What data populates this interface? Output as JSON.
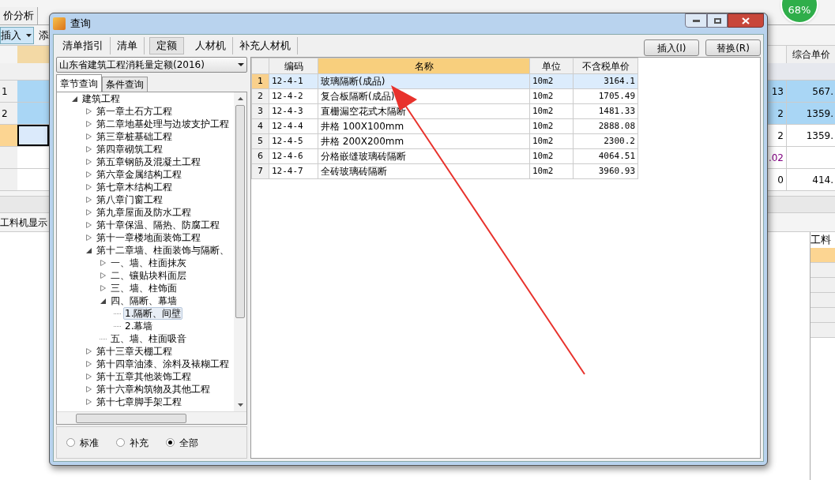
{
  "background": {
    "tab": "价分析",
    "insert_button": "插入",
    "add_button": "添",
    "progress": "68%",
    "price_header": "综合单价",
    "rows": [
      {
        "num": "1",
        "qty": "13",
        "price": "567.",
        "kind": "blue"
      },
      {
        "num": "2",
        "qty": "2",
        "price": "1359.",
        "kind": "blue"
      },
      {
        "num": "",
        "qty": "2",
        "price": "1359.",
        "kind": "current"
      },
      {
        "num": "",
        "qty": ".02",
        "price": "",
        "kind": "plain"
      },
      {
        "num": "",
        "qty": "0",
        "price": "414.",
        "kind": "plain"
      }
    ],
    "bottom_label": "工料机显示",
    "side_header": "工料"
  },
  "dialog": {
    "title": "查询",
    "tabs": [
      {
        "label": "清单指引",
        "selected": false
      },
      {
        "label": "清单",
        "selected": false
      },
      {
        "label": "定额",
        "selected": true
      },
      {
        "label": "人材机",
        "selected": false
      },
      {
        "label": "补充人材机",
        "selected": false
      }
    ],
    "buttons": [
      "插入(I)",
      "替换(R)"
    ],
    "library": "山东省建筑工程消耗量定额(2016)",
    "search_tabs": [
      {
        "label": "章节查询",
        "selected": true
      },
      {
        "label": "条件查询",
        "selected": false
      }
    ],
    "tree": [
      {
        "label": "建筑工程",
        "kind": "branch",
        "expanded": true,
        "selected": false,
        "children": [
          {
            "label": "第一章土石方工程",
            "kind": "branch",
            "expanded": false,
            "selected": false
          },
          {
            "label": "第二章地基处理与边坡支护工程",
            "kind": "branch",
            "expanded": false,
            "selected": false
          },
          {
            "label": "第三章桩基础工程",
            "kind": "branch",
            "expanded": false,
            "selected": false
          },
          {
            "label": "第四章砌筑工程",
            "kind": "branch",
            "expanded": false,
            "selected": false
          },
          {
            "label": "第五章钢筋及混凝土工程",
            "kind": "branch",
            "expanded": false,
            "selected": false
          },
          {
            "label": "第六章金属结构工程",
            "kind": "branch",
            "expanded": false,
            "selected": false
          },
          {
            "label": "第七章木结构工程",
            "kind": "branch",
            "expanded": false,
            "selected": false
          },
          {
            "label": "第八章门窗工程",
            "kind": "branch",
            "expanded": false,
            "selected": false
          },
          {
            "label": "第九章屋面及防水工程",
            "kind": "branch",
            "expanded": false,
            "selected": false
          },
          {
            "label": "第十章保温、隔热、防腐工程",
            "kind": "branch",
            "expanded": false,
            "selected": false
          },
          {
            "label": "第十一章楼地面装饰工程",
            "kind": "branch",
            "expanded": false,
            "selected": false
          },
          {
            "label": "第十二章墙、柱面装饰与隔断、",
            "kind": "branch",
            "expanded": true,
            "selected": false,
            "children": [
              {
                "label": "一、墙、柱面抹灰",
                "kind": "branch",
                "expanded": false,
                "selected": false
              },
              {
                "label": "二、镶贴块料面层",
                "kind": "branch",
                "expanded": false,
                "selected": false
              },
              {
                "label": "三、墙、柱饰面",
                "kind": "branch",
                "expanded": false,
                "selected": false
              },
              {
                "label": "四、隔断、幕墙",
                "kind": "branch",
                "expanded": true,
                "selected": false,
                "children": [
                  {
                    "label": "1.隔断、间壁",
                    "kind": "leaf",
                    "selected": true
                  },
                  {
                    "label": "2.幕墙",
                    "kind": "leaf",
                    "selected": false
                  }
                ]
              },
              {
                "label": "五、墙、柱面吸音",
                "kind": "leaf",
                "selected": false
              }
            ]
          },
          {
            "label": "第十三章天棚工程",
            "kind": "branch",
            "expanded": false,
            "selected": false
          },
          {
            "label": "第十四章油漆、涂料及裱糊工程",
            "kind": "branch",
            "expanded": false,
            "selected": false
          },
          {
            "label": "第十五章其他装饰工程",
            "kind": "branch",
            "expanded": false,
            "selected": false
          },
          {
            "label": "第十六章构筑物及其他工程",
            "kind": "branch",
            "expanded": false,
            "selected": false
          },
          {
            "label": "第十七章脚手架工程",
            "kind": "branch",
            "expanded": false,
            "selected": false
          }
        ]
      }
    ],
    "filters": [
      {
        "label": "标准",
        "selected": false
      },
      {
        "label": "补充",
        "selected": false
      },
      {
        "label": "全部",
        "selected": true
      }
    ],
    "table": {
      "columns": [
        {
          "label": "编码",
          "selected": false
        },
        {
          "label": "名称",
          "selected": true
        },
        {
          "label": "单位",
          "selected": false
        },
        {
          "label": "不含税单价",
          "selected": false
        }
      ],
      "rows": [
        {
          "index": "1",
          "code": "12-4-1",
          "name": "玻璃隔断(成品)",
          "unit": "10m2",
          "price": "3164.1",
          "selected": true
        },
        {
          "index": "2",
          "code": "12-4-2",
          "name": "复合板隔断(成品)",
          "unit": "10m2",
          "price": "1705.49",
          "selected": false
        },
        {
          "index": "3",
          "code": "12-4-3",
          "name": "直栅漏空花式木隔断",
          "unit": "10m2",
          "price": "1481.33",
          "selected": false
        },
        {
          "index": "4",
          "code": "12-4-4",
          "name": "井格 100X100mm",
          "unit": "10m2",
          "price": "2888.08",
          "selected": false
        },
        {
          "index": "5",
          "code": "12-4-5",
          "name": "井格 200X200mm",
          "unit": "10m2",
          "price": "2300.2",
          "selected": false
        },
        {
          "index": "6",
          "code": "12-4-6",
          "name": "分格嵌缝玻璃砖隔断",
          "unit": "10m2",
          "price": "4064.51",
          "selected": false
        },
        {
          "index": "7",
          "code": "12-4-7",
          "name": "全砖玻璃砖隔断",
          "unit": "10m2",
          "price": "3960.93",
          "selected": false
        }
      ]
    }
  }
}
